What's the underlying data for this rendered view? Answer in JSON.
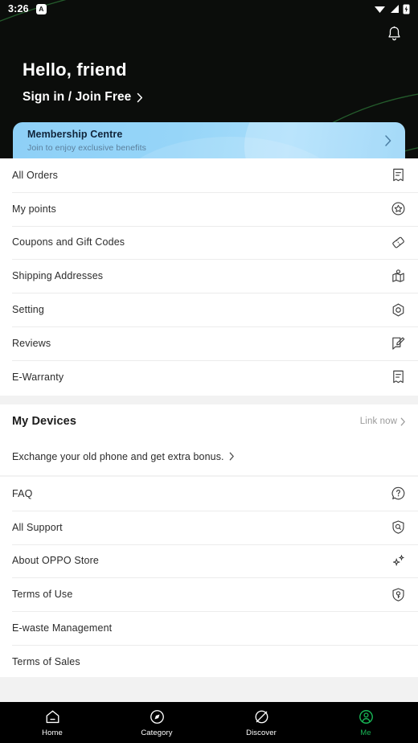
{
  "status_bar": {
    "time": "3:26",
    "badge": "A",
    "icons": [
      "wifi-icon",
      "cellular-signal-icon",
      "battery-charging-icon"
    ]
  },
  "header": {
    "notification_icon": "bell-icon",
    "greeting": "Hello, friend",
    "signin_label": "Sign in / Join Free",
    "signin_chevron": "chevron-right-icon",
    "background_color": "#0b0d0b",
    "arc_color": "#1f5a2c"
  },
  "membership_card": {
    "title": "Membership Centre",
    "subtitle": "Join to enjoy exclusive benefits",
    "chevron": "chevron-right-icon",
    "accent_color": "#8ed0f7"
  },
  "account_menu": [
    {
      "label": "All Orders",
      "icon": "receipt-icon"
    },
    {
      "label": "My points",
      "icon": "star-circle-icon"
    },
    {
      "label": "Coupons and Gift Codes",
      "icon": "coupon-icon"
    },
    {
      "label": "Shipping Addresses",
      "icon": "map-location-icon"
    },
    {
      "label": "Setting",
      "icon": "gear-hexagon-icon"
    },
    {
      "label": "Reviews",
      "icon": "edit-review-icon"
    },
    {
      "label": "E-Warranty",
      "icon": "warranty-receipt-icon"
    }
  ],
  "devices": {
    "title": "My Devices",
    "link_label": "Link now",
    "link_chevron": "chevron-right-icon",
    "exchange_label": "Exchange your old phone and get extra bonus.",
    "exchange_chevron": "chevron-right-icon"
  },
  "support_menu": [
    {
      "label": "FAQ",
      "icon": "question-bubble-icon"
    },
    {
      "label": "All Support",
      "icon": "shield-search-icon"
    },
    {
      "label": "About OPPO Store",
      "icon": "sparkles-icon"
    },
    {
      "label": "Terms of Use",
      "icon": "shield-key-icon"
    },
    {
      "label": "E-waste Management",
      "icon": ""
    },
    {
      "label": "Terms of Sales",
      "icon": ""
    }
  ],
  "bottom_nav": {
    "active_color": "#18b455",
    "items": [
      {
        "label": "Home",
        "icon": "home-icon",
        "active": false
      },
      {
        "label": "Category",
        "icon": "compass-icon",
        "active": false
      },
      {
        "label": "Discover",
        "icon": "planet-icon",
        "active": false
      },
      {
        "label": "Me",
        "icon": "person-circle-icon",
        "active": true
      }
    ]
  }
}
